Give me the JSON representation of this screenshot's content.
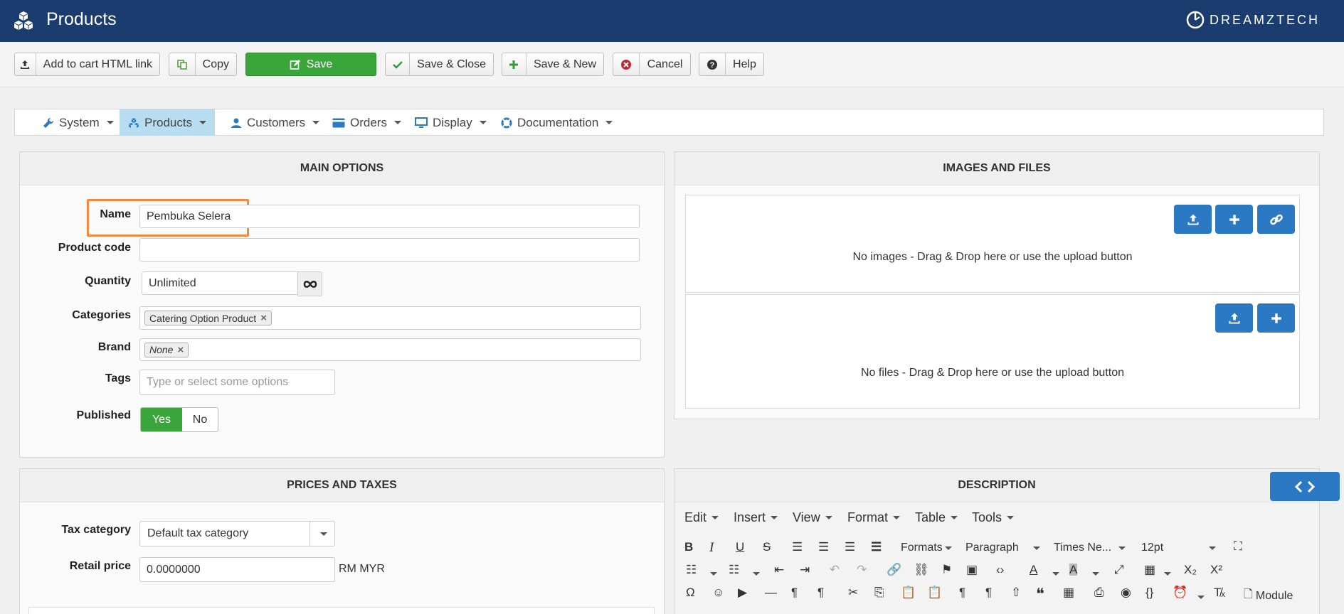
{
  "header": {
    "title": "Products",
    "brand": "DREAMZTECH"
  },
  "toolbar": {
    "add_to_cart": "Add to cart HTML link",
    "copy": "Copy",
    "save": "Save",
    "save_close": "Save & Close",
    "save_new": "Save & New",
    "cancel": "Cancel",
    "help": "Help"
  },
  "menu": {
    "system": "System",
    "products": "Products",
    "customers": "Customers",
    "orders": "Orders",
    "display": "Display",
    "documentation": "Documentation"
  },
  "main_options": {
    "heading": "MAIN OPTIONS",
    "name_label": "Name",
    "name_value": "Pembuka Selera",
    "product_code_label": "Product code",
    "product_code_value": "",
    "quantity_label": "Quantity",
    "quantity_value": "Unlimited",
    "categories_label": "Categories",
    "category_chip": "Catering Option Product",
    "brand_label": "Brand",
    "brand_chip": "None",
    "tags_label": "Tags",
    "tags_placeholder": "Type or select some options",
    "published_label": "Published",
    "published_yes": "Yes",
    "published_no": "No",
    "published_selected": "Yes"
  },
  "images_files": {
    "heading": "IMAGES AND FILES",
    "no_images": "No images - Drag & Drop here or use the upload button",
    "no_files": "No files - Drag & Drop here or use the upload button"
  },
  "prices": {
    "heading": "PRICES AND TAXES",
    "tax_label": "Tax category",
    "tax_value": "Default tax category",
    "retail_label": "Retail price",
    "retail_value": "0.0000000",
    "currency": "RM MYR"
  },
  "description": {
    "heading": "DESCRIPTION",
    "menus": [
      "Edit",
      "Insert",
      "View",
      "Format",
      "Table",
      "Tools"
    ],
    "formats": "Formats",
    "paragraph": "Paragraph",
    "font": "Times Ne...",
    "size": "12pt",
    "module": "Module"
  },
  "colors": {
    "header_bg": "#1b3c6e",
    "save_green": "#3aa53a",
    "accent_blue": "#2b79c2",
    "highlight_orange": "#f08a3c"
  }
}
